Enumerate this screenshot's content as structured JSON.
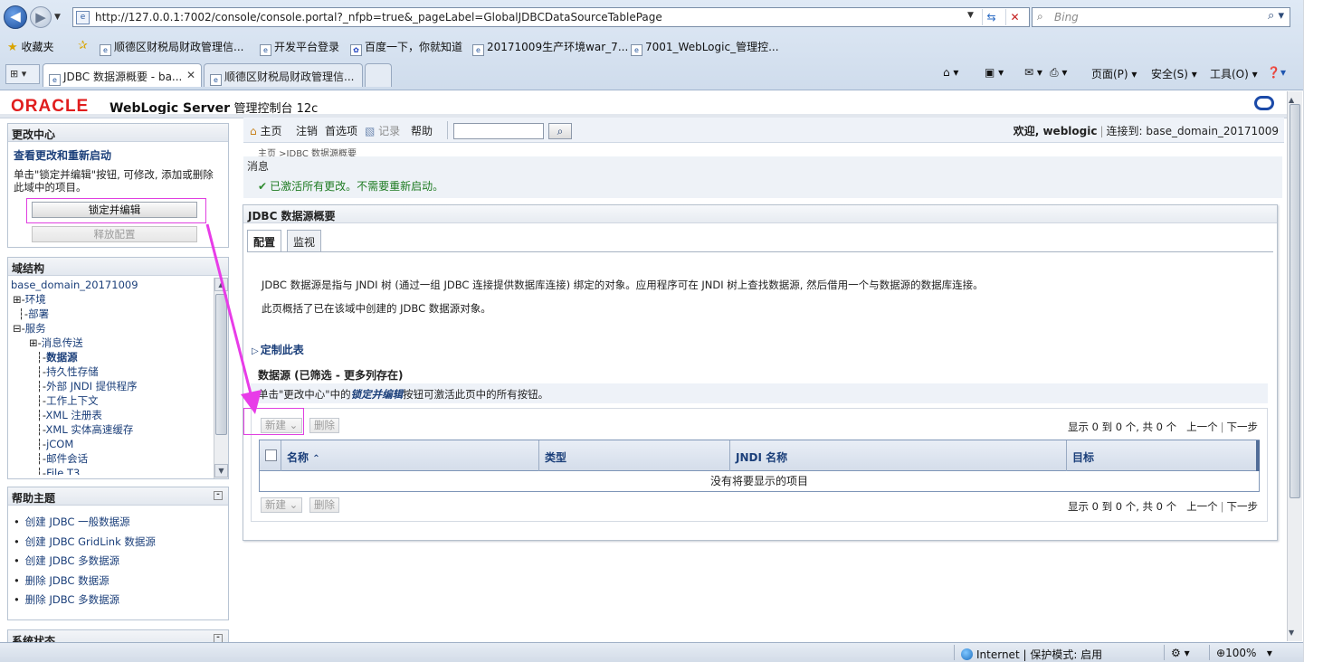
{
  "browser": {
    "url": "http://127.0.0.1:7002/console/console.portal?_nfpb=true&_pageLabel=GlobalJDBCDataSourceTablePage",
    "search_placeholder": "Bing",
    "favorites_label": "收藏夹",
    "favorites": [
      "顺德区财税局财政管理信...",
      "开发平台登录",
      "百度一下，你就知道",
      "20171009生产环境war_7...",
      "7001_WebLogic_管理控..."
    ],
    "tabs": [
      {
        "label": "JDBC 数据源概要 - ba..."
      },
      {
        "label": "顺德区财税局财政管理信..."
      }
    ],
    "commands": {
      "page": "页面(P)",
      "safety": "安全(S)",
      "tools": "工具(O)"
    },
    "status": {
      "zone": "Internet | 保护模式: 启用",
      "zoom": "100%"
    }
  },
  "console": {
    "brand": "ORACLE",
    "product": "WebLogic Server",
    "product_suffix": "管理控制台 12c",
    "toolbar": {
      "home": "主页",
      "logout": "注销",
      "preferences": "首选项",
      "record": "记录",
      "help": "帮助"
    },
    "welcome_label": "欢迎, weblogic",
    "connected_label": "连接到: base_domain_20171009",
    "breadcrumb": "主页 >JDBC 数据源概要"
  },
  "change_center": {
    "title": "更改中心",
    "subtitle": "查看更改和重新启动",
    "description": "单击\"锁定并编辑\"按钮, 可修改, 添加或删除此域中的项目。",
    "lock_button": "锁定并编辑",
    "release_button": "释放配置"
  },
  "domain_structure": {
    "title": "域结构",
    "items": [
      {
        "label": "base_domain_20171009",
        "prefix": ""
      },
      {
        "label": "环境",
        "prefix": "⊞-"
      },
      {
        "label": "部署",
        "prefix": "  ┆-"
      },
      {
        "label": "服务",
        "prefix": "⊟-"
      },
      {
        "label": "消息传送",
        "prefix": "    ┆ ⊞-"
      },
      {
        "label": "数据源",
        "prefix": "    ┆  ┆-"
      },
      {
        "label": "持久性存储",
        "prefix": "    ┆  ┆-"
      },
      {
        "label": "外部 JNDI 提供程序",
        "prefix": "    ┆  ┆-"
      },
      {
        "label": "工作上下文",
        "prefix": "    ┆  ┆-"
      },
      {
        "label": "XML 注册表",
        "prefix": "    ┆  ┆-"
      },
      {
        "label": "XML 实体高速缓存",
        "prefix": "    ┆  ┆-"
      },
      {
        "label": "jCOM",
        "prefix": "    ┆  ┆-"
      },
      {
        "label": "邮件会话",
        "prefix": "    ┆  ┆-"
      },
      {
        "label": "File T3",
        "prefix": "    ┆  ┆-"
      }
    ]
  },
  "help_topics": {
    "title": "帮助主题",
    "items": [
      "创建 JDBC 一般数据源",
      "创建 JDBC GridLink 数据源",
      "创建 JDBC 多数据源",
      "删除 JDBC 数据源",
      "删除 JDBC 多数据源"
    ]
  },
  "system_status": {
    "title": "系统状态"
  },
  "messages": {
    "label": "消息",
    "ok": "已激活所有更改。不需要重新启动。"
  },
  "main": {
    "title": "JDBC 数据源概要",
    "tabs": [
      "配置",
      "监视"
    ],
    "description1": "JDBC 数据源是指与 JNDI 树 (通过一组 JDBC 连接提供数据库连接) 绑定的对象。应用程序可在 JNDI 树上查找数据源, 然后借用一个与数据源的数据库连接。",
    "description2": "此页概括了已在该域中创建的 JDBC 数据源对象。",
    "customize": "定制此表",
    "table_title": "数据源 (已筛选 - 更多列存在)",
    "hint_prefix": "单击\"更改中心\"中的",
    "hint_emph": "锁定并编辑",
    "hint_suffix": "按钮可激活此页中的所有按钮。",
    "new_button": "新建",
    "delete_button": "删除",
    "pager_text": "显示 0 到 0 个, 共 0 个",
    "prev": "上一个",
    "next": "下一步",
    "columns": [
      "名称",
      "类型",
      "JNDI 名称",
      "目标"
    ],
    "empty_text": "没有将要显示的项目"
  }
}
